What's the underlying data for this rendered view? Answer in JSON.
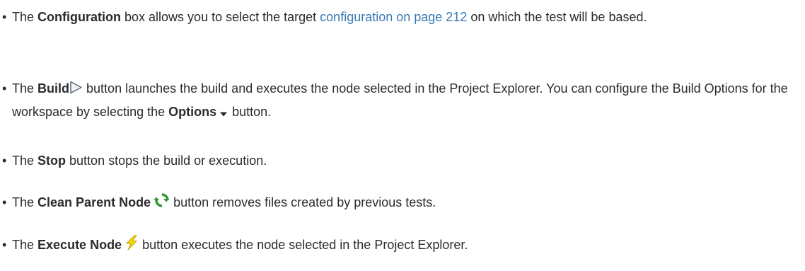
{
  "items": [
    {
      "pre": "The ",
      "bold": "Configuration",
      "mid": " box allows you to select the target ",
      "link": "configuration on page 212",
      "post": " on which the test will be based."
    },
    {
      "pre": "The ",
      "bold": "Build",
      "icon": "play-triangle-icon",
      "mid": " button launches the build and executes the node selected in the Project Explorer. You can configure the Build Options for the workspace by selecting the ",
      "bold2": "Options",
      "icon2": "dropdown-arrow-icon",
      "post": " button."
    },
    {
      "pre": "The ",
      "bold": "Stop",
      "post": " button stops the build or execution."
    },
    {
      "pre": "The ",
      "bold": "Clean Parent Node",
      "icon": "refresh-cycle-icon",
      "post": " button removes files created by previous tests."
    },
    {
      "pre": "The ",
      "bold": "Execute Node",
      "icon": "lightning-icon",
      "post": " button executes the node selected in the Project Explorer."
    }
  ],
  "colors": {
    "link": "#3a7ab3",
    "text": "#2b2b2b",
    "refresh_icon": "#2e9a2e",
    "lightning_icon": "#e6c200"
  }
}
